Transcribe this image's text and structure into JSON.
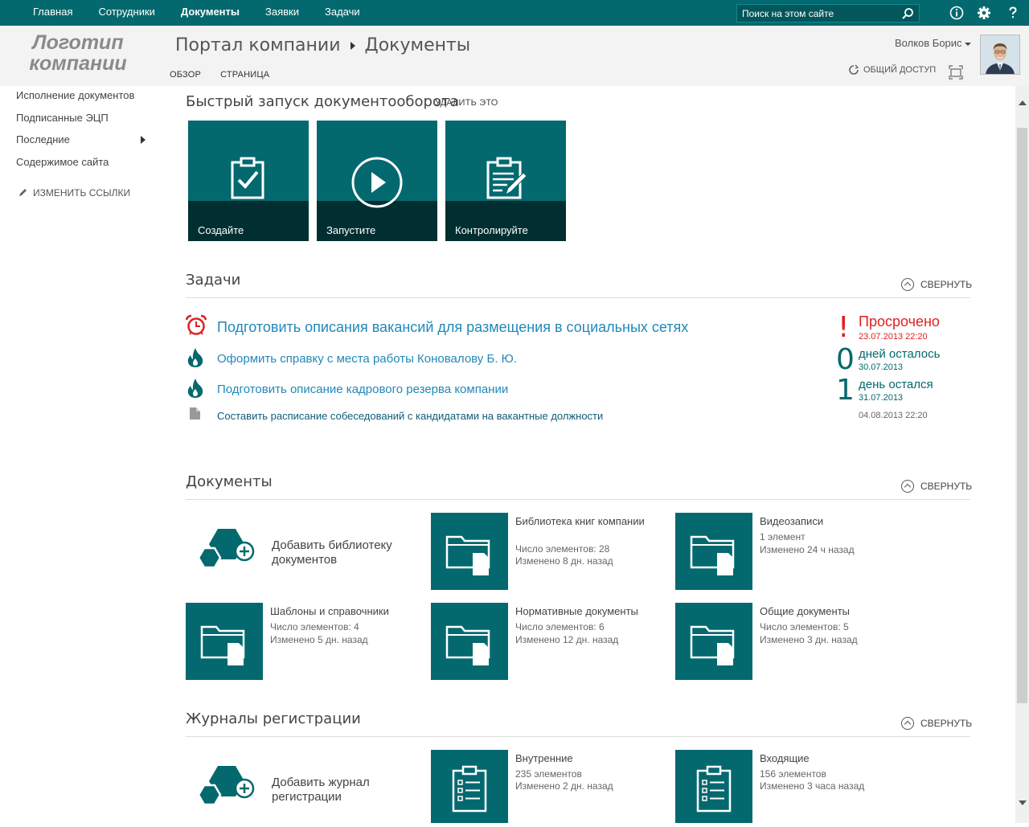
{
  "topnav": {
    "items": [
      "Главная",
      "Сотрудники",
      "Документы",
      "Заявки",
      "Задачи"
    ],
    "active_index": 2
  },
  "search": {
    "placeholder": "Поиск на этом сайте"
  },
  "header": {
    "logo_line1": "Логотип",
    "logo_line2": "компании",
    "breadcrumb_root": "Портал компании",
    "breadcrumb_current": "Документы",
    "tabs": [
      "ОБЗОР",
      "СТРАНИЦА"
    ],
    "user_name": "Волков Борис",
    "share_label": "ОБЩИЙ ДОСТУП"
  },
  "leftnav": {
    "items": [
      "Исполнение документов",
      "Подписанные ЭЦП",
      "Последние",
      "Содержимое сайта"
    ],
    "edit_links": "ИЗМЕНИТЬ ССЫЛКИ"
  },
  "quicklaunch": {
    "title": "Быстрый запуск документооборота",
    "remove_label": "УДАЛИТЬ ЭТО",
    "tiles": [
      {
        "label": "Создайте",
        "icon": "clipboard-check-icon"
      },
      {
        "label": "Запустите",
        "icon": "play-circle-icon"
      },
      {
        "label": "Контролируйте",
        "icon": "clipboard-edit-icon"
      }
    ]
  },
  "tasks": {
    "title": "Задачи",
    "collapse_label": "СВЕРНУТЬ",
    "items": [
      {
        "title": "Подготовить описания вакансий для размещения в социальных сетях",
        "icon": "alarm-clock-icon"
      },
      {
        "title": "Оформить справку с места работы Коновалову Б. Ю.",
        "icon": "flame-icon"
      },
      {
        "title": "Подготовить описание кадрового резерва компании",
        "icon": "flame-icon"
      },
      {
        "title": "Составить расписание собеседований с кандидатами на вакантные должности",
        "icon": "document-icon"
      }
    ],
    "status": [
      {
        "big": "!",
        "label": "Просрочено",
        "date": "23.07.2013 22:20",
        "color": "#e02020"
      },
      {
        "big": "0",
        "label": "дней осталось",
        "date": "30.07.2013",
        "color": "#03696e"
      },
      {
        "big": "1",
        "label": "день остался",
        "date": "31.07.2013",
        "color": "#03696e"
      },
      {
        "big": "",
        "label": "",
        "date": "04.08.2013 22:20",
        "color": "#666666"
      }
    ]
  },
  "documents": {
    "title": "Документы",
    "collapse_label": "СВЕРНУТЬ",
    "add_label": "Добавить библиотеку документов",
    "libraries": [
      {
        "title": "Библиотека книг компании",
        "line1": "Число элементов: 28",
        "line2": "Изменено 8 дн. назад"
      },
      {
        "title": "Видеозаписи",
        "line1": "1 элемент",
        "line2": "Изменено 24 ч назад"
      },
      {
        "title": "Шаблоны и справочники",
        "line1": "Число элементов: 4",
        "line2": "Изменено 5 дн. назад"
      },
      {
        "title": "Нормативные документы",
        "line1": "Число элементов: 6",
        "line2": "Изменено 12 дн. назад"
      },
      {
        "title": "Общие документы",
        "line1": "Число элементов: 5",
        "line2": "Изменено 3 дн. назад"
      }
    ]
  },
  "journals": {
    "title": "Журналы регистрации",
    "collapse_label": "СВЕРНУТЬ",
    "add_label": "Добавить журнал регистрации",
    "items": [
      {
        "title": "Внутренние",
        "line1": "235 элементов",
        "line2": "Изменено 2 дн. назад"
      },
      {
        "title": "Входящие",
        "line1": "156 элементов",
        "line2": "Изменено 3 часа назад"
      }
    ]
  },
  "colors": {
    "accent": "#03696e",
    "overdue": "#e02020",
    "link": "#2288b8"
  }
}
